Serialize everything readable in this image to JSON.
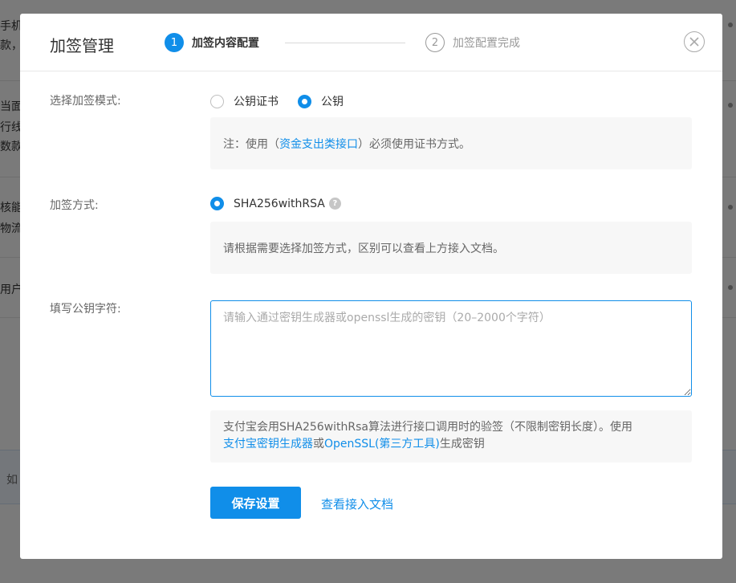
{
  "background": {
    "snippets": [
      "手机",
      "款，",
      "当面",
      "行线",
      "数款",
      "核能",
      "物流",
      "用户",
      "如"
    ]
  },
  "modal": {
    "title": "加签管理",
    "steps": [
      {
        "num": "1",
        "label": "加签内容配置"
      },
      {
        "num": "2",
        "label": "加签配置完成"
      }
    ],
    "close_icon": "close-circle-icon"
  },
  "sign_mode": {
    "label": "选择加签模式:",
    "options": [
      "公钥证书",
      "公钥"
    ],
    "selected": "公钥",
    "note_prefix": "注：使用（",
    "note_link": "资金支出类接口",
    "note_suffix": "）必须使用证书方式。"
  },
  "sign_method": {
    "label": "加签方式:",
    "option": "SHA256withRSA",
    "help_icon": "question-icon",
    "note": "请根据需要选择加签方式，区别可以查看上方接入文档。"
  },
  "public_key": {
    "label": "填写公钥字符:",
    "value": "",
    "placeholder": "请输入通过密钥生成器或openssl生成的密钥（20–2000个字符）",
    "note_line1": "支付宝会用SHA256withRsa算法进行接口调用时的验签（不限制密钥长度）。使用",
    "note_link1": "支付宝密钥生成器",
    "note_or": "或",
    "note_link2": "OpenSSL(第三方工具)",
    "note_end": "生成密钥"
  },
  "actions": {
    "save": "保存设置",
    "view_docs": "查看接入文档"
  },
  "colors": {
    "primary": "#108ee9",
    "overlay": "rgba(0,0,0,0.5)"
  }
}
